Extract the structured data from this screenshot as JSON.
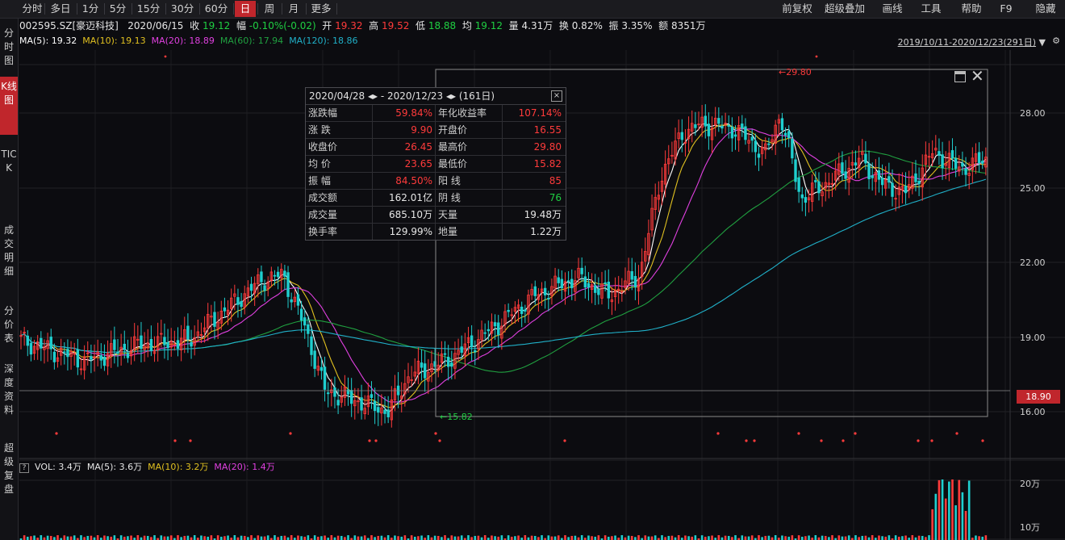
{
  "toolbar": {
    "periods": [
      "分时",
      "多日",
      "1分",
      "5分",
      "15分",
      "30分",
      "60分",
      "日",
      "周",
      "月",
      "更多"
    ],
    "active_period": "日",
    "right_menu": [
      "前复权",
      "超级叠加",
      "画线",
      "工具",
      "帮助",
      "F9",
      "隐藏"
    ]
  },
  "leftnav": {
    "items": [
      "分时图",
      "K线图",
      "TICK",
      "成交明细",
      "分价表",
      "深度资料",
      "超级复盘"
    ],
    "active": "K线图"
  },
  "info": {
    "code": "002595.SZ[豪迈科技]",
    "date": "2020/06/15",
    "close_label": "收",
    "close": "19.12",
    "change_label": "幅",
    "change": "-0.10%(-0.02)",
    "open_label": "开",
    "open": "19.32",
    "high_label": "高",
    "high": "19.52",
    "low_label": "低",
    "low": "18.88",
    "avg_label": "均",
    "avg": "19.12",
    "vol_label": "量",
    "vol": "4.31万",
    "turnover_label": "换",
    "turnover": "0.82%",
    "amp_label": "振",
    "amp": "3.35%",
    "amount_label": "额",
    "amount": "8351万"
  },
  "ma": {
    "ma5": "MA(5): 19.32",
    "ma10": "MA(10): 19.13",
    "ma20": "MA(20): 18.89",
    "ma60": "MA(60): 17.94",
    "ma120": "MA(120): 18.86"
  },
  "date_range": "2019/10/11-2020/12/23(291日)",
  "stats": {
    "title": "2020/04/28 ◂▸ - 2020/12/23 ◂▸  (161日)",
    "rows": [
      [
        "涨跌幅",
        "59.84%",
        "年化收益率",
        "107.14%"
      ],
      [
        "涨  跌",
        "9.90",
        "开盘价",
        "16.55"
      ],
      [
        "收盘价",
        "26.45",
        "最高价",
        "29.80"
      ],
      [
        "均  价",
        "23.65",
        "最低价",
        "15.82"
      ],
      [
        "振  幅",
        "84.50%",
        "阳  线",
        "85"
      ],
      [
        "成交额",
        "162.01亿",
        "阴  线",
        "76"
      ],
      [
        "成交量",
        "685.10万",
        "天量",
        "19.48万"
      ],
      [
        "换手率",
        "129.99%",
        "地量",
        "1.22万"
      ]
    ]
  },
  "axis": {
    "price_ticks": [
      "28.00",
      "25.00",
      "22.00",
      "19.00",
      "16.00"
    ],
    "current_price": "18.90",
    "vol_ticks": [
      "20万",
      "10万"
    ],
    "high_marker": "29.80",
    "low_marker": "15.82"
  },
  "vol": {
    "vol": "VOL: 3.4万",
    "ma5": "MA(5): 3.6万",
    "ma10": "MA(10): 3.2万",
    "ma20": "MA(20): 1.4万"
  },
  "colors": {
    "up": "#ff3b3b",
    "down": "#1fcfcf",
    "ma5": "#ffffff",
    "ma10": "#e0c020",
    "ma20": "#e040e0",
    "ma60": "#20a040",
    "ma120": "#20b0c8",
    "accent": "#c0262c"
  }
}
